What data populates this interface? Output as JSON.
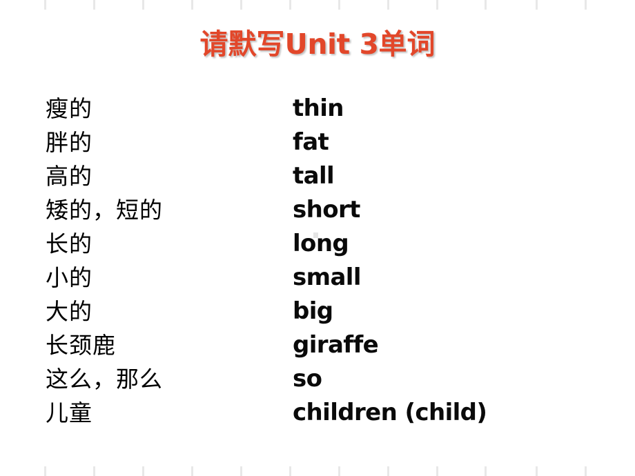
{
  "slide": {
    "background_color": "#ffffff",
    "title": {
      "chinese_prefix": "请默写",
      "english_part": "Unit 3",
      "chinese_suffix": " 单词",
      "full_text": "请默写Unit 3 单词",
      "color": "#e2472a",
      "shadow_color": "#8c8c8c"
    },
    "guides": {
      "tick_color": "#e8e8e8",
      "tick_spacing_px": 71,
      "top_positions": [
        64,
        135,
        206,
        277,
        348,
        419,
        490,
        561,
        632,
        702,
        776,
        847
      ],
      "bottom_positions": [
        64,
        135,
        206,
        277,
        348,
        419,
        490,
        561,
        632,
        702,
        776,
        847
      ]
    },
    "word_list": {
      "columns": [
        "chinese",
        "english"
      ],
      "rows": [
        {
          "chinese": "瘦的",
          "english": "thin"
        },
        {
          "chinese": "胖的",
          "english": "fat"
        },
        {
          "chinese": "高的",
          "english": "tall"
        },
        {
          "chinese": "矮的，短的",
          "english": "short"
        },
        {
          "chinese": "长的",
          "english": "long"
        },
        {
          "chinese": "小的",
          "english": "small"
        },
        {
          "chinese": "大的",
          "english": "big"
        },
        {
          "chinese": "长颈鹿",
          "english": "giraffe"
        },
        {
          "chinese": "这么，那么",
          "english": "so"
        },
        {
          "chinese": "儿童",
          "english": "children (child)"
        }
      ]
    }
  }
}
